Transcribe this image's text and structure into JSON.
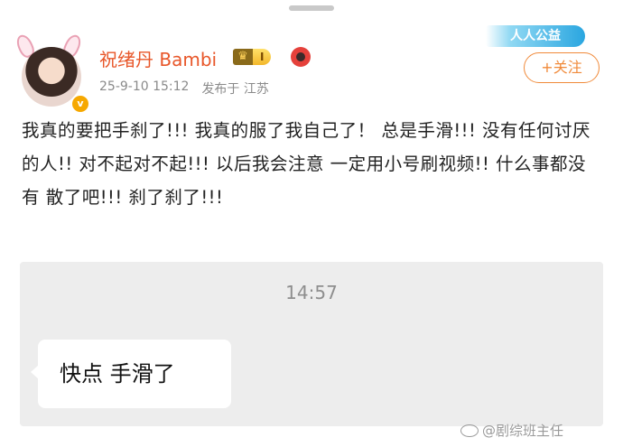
{
  "post": {
    "username": "祝绪丹 Bambi",
    "vip_level": "I",
    "date": "25-9-10 15:12",
    "location": "发布于 江苏",
    "follow_label": "+关注",
    "public_badge_text": "人人公益",
    "verified_symbol": "v",
    "text": "我真的要把手刹了!!! 我真的服了我自己了！ 总是手滑!!! 没有任何讨厌的人!! 对不起对不起!!! 以后我会注意 一定用小号刷视频!! 什么事都没有 散了吧!!! 刹了刹了!!!"
  },
  "chat_image": {
    "time": "14:57",
    "message": "快点 手滑了"
  },
  "watermark": "@剧综班主任",
  "icons": {
    "avatar": "avatar-with-bunny-ears",
    "verified": "verified-badge-icon",
    "vip": "crown-icon",
    "fan": "fan-badge-icon",
    "weibo": "weibo-eye-icon"
  },
  "colors": {
    "username": "#e8572a",
    "follow_accent": "#f08a3a",
    "verified": "#f6a800",
    "card_bg": "#ededed"
  }
}
